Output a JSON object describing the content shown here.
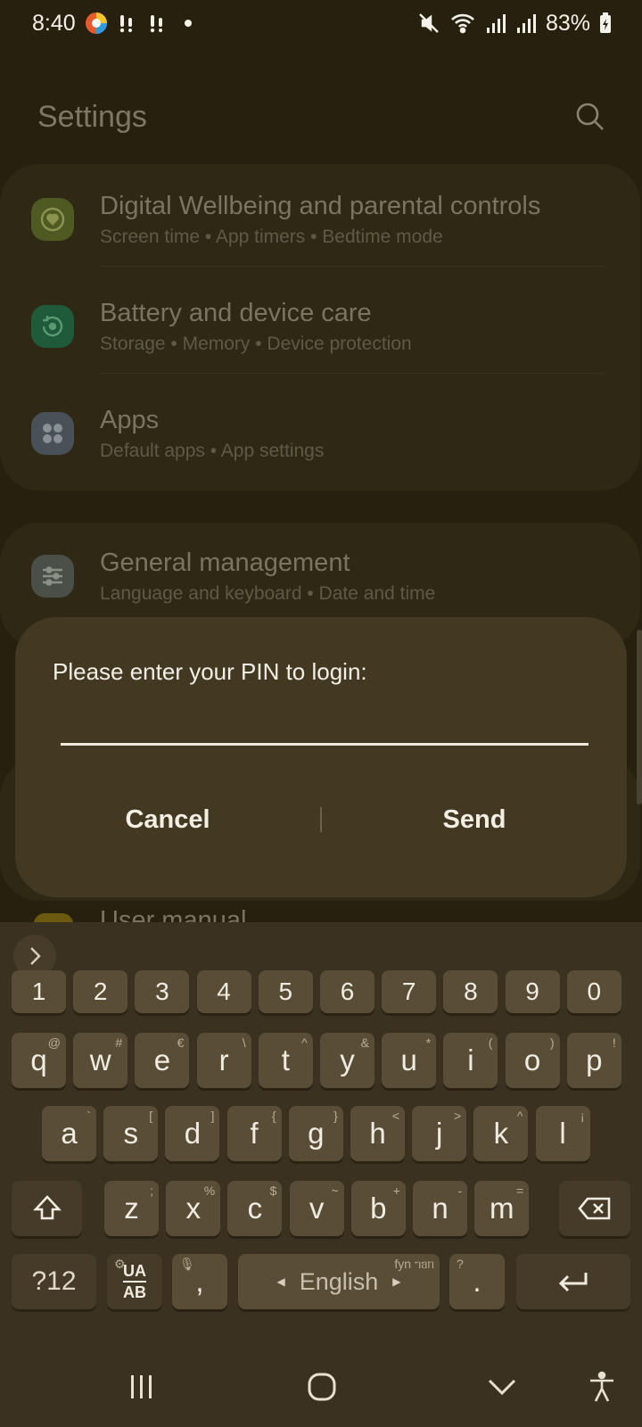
{
  "status_bar": {
    "time": "8:40",
    "battery": "83%",
    "icons": [
      "app-notification-icon",
      "sim-alert-icon",
      "sim-alert-icon",
      "mute-icon",
      "wifi-icon",
      "signal-icon",
      "signal-icon",
      "battery-charging-icon"
    ]
  },
  "settings": {
    "title": "Settings",
    "items": [
      {
        "title": "Digital Wellbeing and parental controls",
        "subtitle": "Screen time  •  App timers  •  Bedtime mode",
        "icon": "wellbeing-icon",
        "color": "#4f5a22"
      },
      {
        "title": "Battery and device care",
        "subtitle": "Storage  •  Memory  •  Device protection",
        "icon": "device-care-icon",
        "color": "#1f5a3a"
      },
      {
        "title": "Apps",
        "subtitle": "Default apps  •  App settings",
        "icon": "apps-icon",
        "color": "#4a5058"
      },
      {
        "title": "General management",
        "subtitle": "Language and keyboard  •  Date and time",
        "icon": "sliders-icon",
        "color": "#4a5048"
      }
    ],
    "partial_item": "User manual"
  },
  "dialog": {
    "message": "Please enter your PIN to login:",
    "pin_value": "",
    "cancel_label": "Cancel",
    "send_label": "Send"
  },
  "keyboard": {
    "numbers": [
      "1",
      "2",
      "3",
      "4",
      "5",
      "6",
      "7",
      "8",
      "9",
      "0"
    ],
    "row1": [
      {
        "k": "q",
        "h": "@"
      },
      {
        "k": "w",
        "h": "#"
      },
      {
        "k": "e",
        "h": "€"
      },
      {
        "k": "r",
        "h": "\\"
      },
      {
        "k": "t",
        "h": "^"
      },
      {
        "k": "y",
        "h": "&"
      },
      {
        "k": "u",
        "h": "*"
      },
      {
        "k": "i",
        "h": "("
      },
      {
        "k": "o",
        "h": ")"
      },
      {
        "k": "p",
        "h": "!"
      }
    ],
    "row2": [
      {
        "k": "a",
        "h": "`"
      },
      {
        "k": "s",
        "h": "["
      },
      {
        "k": "d",
        "h": "]"
      },
      {
        "k": "f",
        "h": "{"
      },
      {
        "k": "g",
        "h": "}"
      },
      {
        "k": "h",
        "h": "<"
      },
      {
        "k": "j",
        "h": ">"
      },
      {
        "k": "k",
        "h": "^"
      },
      {
        "k": "l",
        "h": "¡"
      }
    ],
    "row3": [
      {
        "k": "z",
        "h": ";"
      },
      {
        "k": "x",
        "h": "%"
      },
      {
        "k": "c",
        "h": "$"
      },
      {
        "k": "v",
        "h": "~"
      },
      {
        "k": "b",
        "h": "+"
      },
      {
        "k": "n",
        "h": "-"
      },
      {
        "k": "m",
        "h": "="
      }
    ],
    "symbols_label": "?12",
    "lang_top": "UA",
    "lang_bottom": "AB",
    "comma": ",",
    "comma_hint": "🎙",
    "space_label": "English",
    "space_hint": "fyn ᥐᥑᥒ",
    "period": ".",
    "period_hint": "?"
  }
}
